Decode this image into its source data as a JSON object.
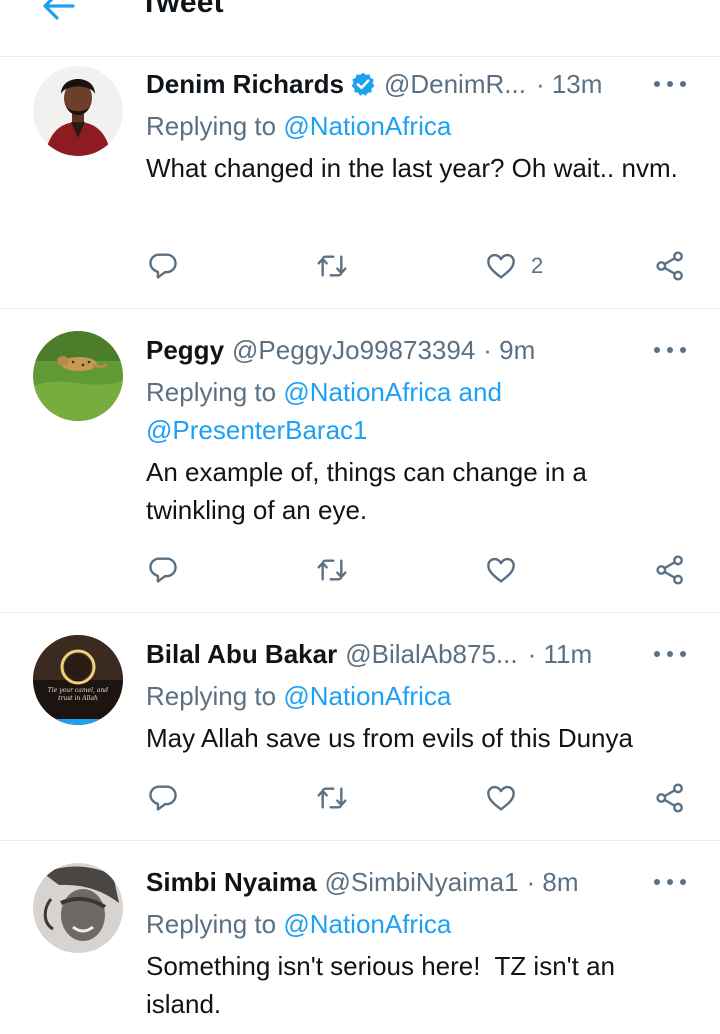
{
  "header": {
    "title": "Tweet"
  },
  "tweets": [
    {
      "name": "Denim Richards",
      "verified": true,
      "handle": "@DenimR...",
      "time": "· 13m",
      "replying_prefix": "Replying to ",
      "replying_line1": "@NationAfrica",
      "replying_line2": "",
      "text": "What changed in the last year? Oh wait.. nvm.",
      "likes": "2"
    },
    {
      "name": "Peggy",
      "verified": false,
      "handle": "@PeggyJo99873394",
      "time": "· 9m",
      "replying_prefix": "Replying to ",
      "replying_line1": "@NationAfrica and",
      "replying_line2": "@PresenterBarac1",
      "text": "An example of, things can change in a twinkling of an eye.",
      "likes": ""
    },
    {
      "name": "Bilal Abu Bakar",
      "verified": false,
      "handle": "@BilalAb875...",
      "time": "· 11m",
      "replying_prefix": "Replying to ",
      "replying_line1": "@NationAfrica",
      "replying_line2": "",
      "text": "May Allah save us from evils of this Dunya",
      "likes": "",
      "avatar_text": "Tie your camel, and trust in Allah"
    },
    {
      "name": "Simbi Nyaima",
      "verified": false,
      "handle": "@SimbiNyaima1",
      "time": "· 8m",
      "replying_prefix": "Replying to ",
      "replying_line1": "@NationAfrica",
      "replying_line2": "",
      "text": "Something isn't serious here!  TZ isn't an island.",
      "likes": ""
    }
  ],
  "colors": {
    "accent": "#1da1f2",
    "secondary_text": "#5b7083",
    "divider": "#e6ecf0"
  },
  "icons": [
    "back-arrow-icon",
    "verified-badge-icon",
    "more-icon",
    "reply-icon",
    "retweet-icon",
    "like-icon",
    "share-icon"
  ]
}
